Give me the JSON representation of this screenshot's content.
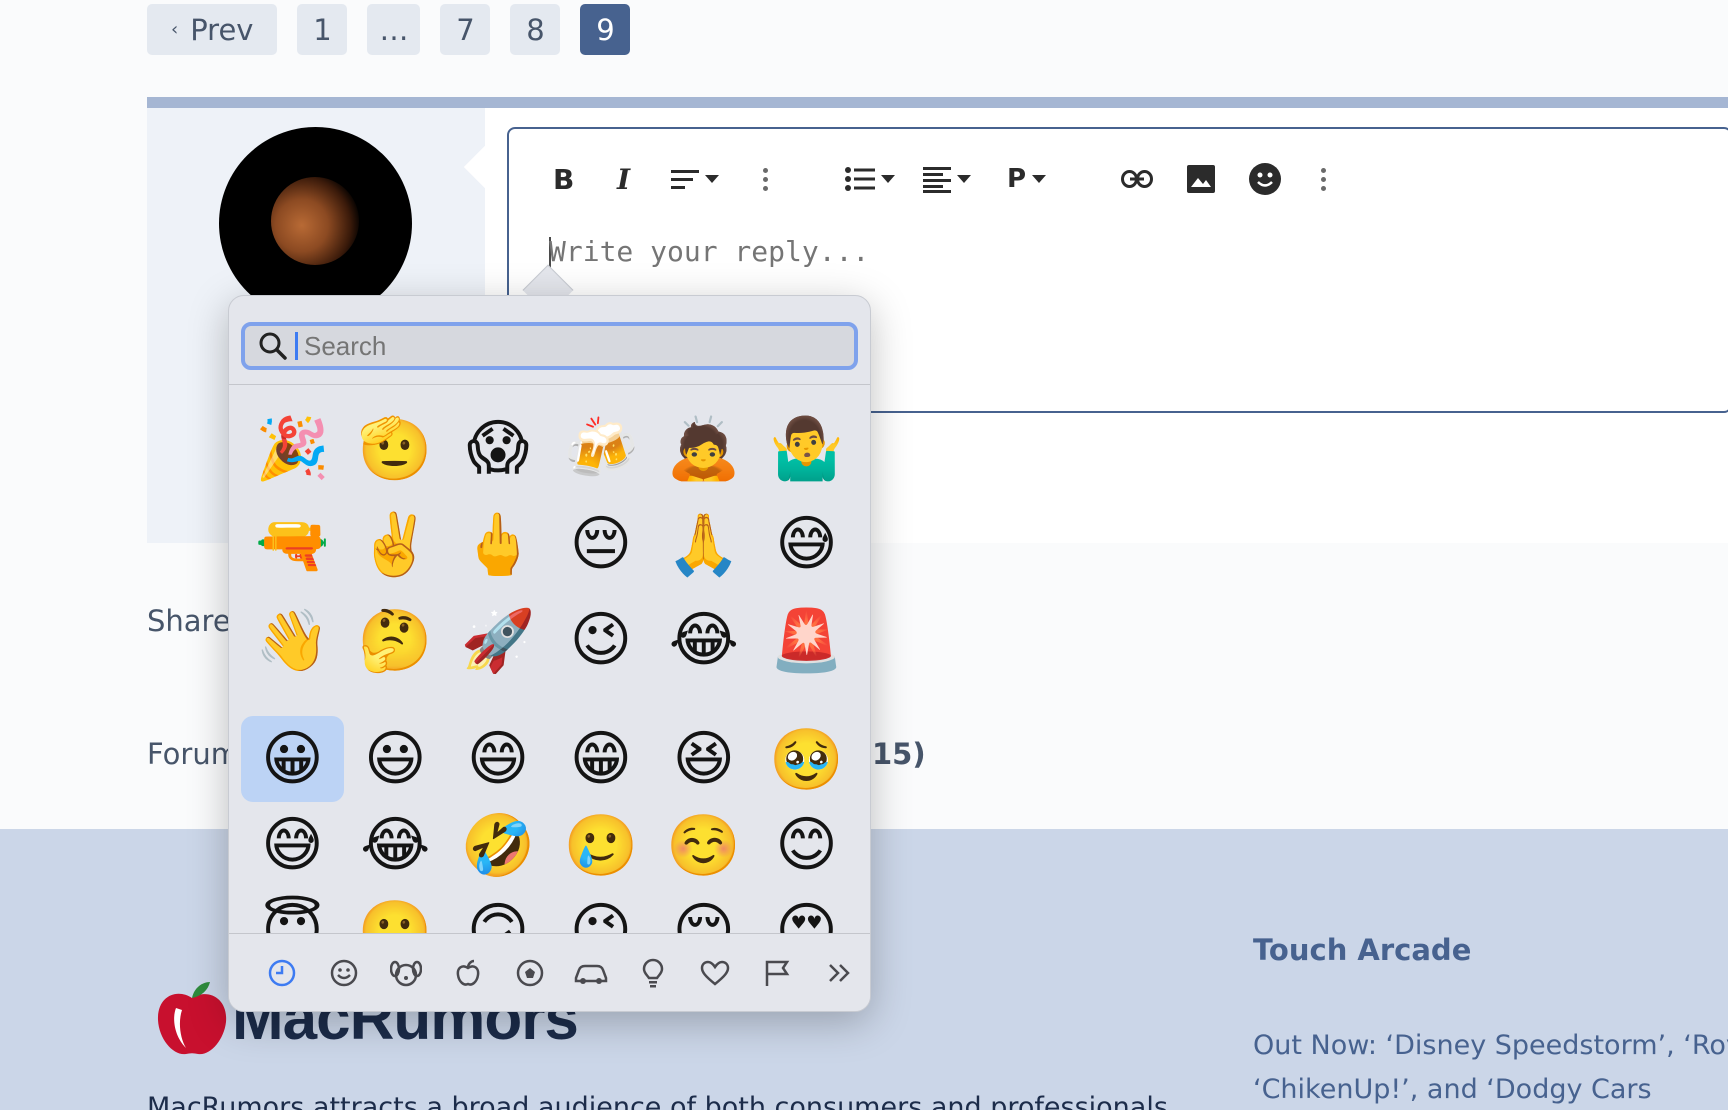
{
  "pagination": {
    "prev_label": "Prev",
    "pages": [
      "1",
      "…",
      "7",
      "8",
      "9"
    ],
    "current": "9"
  },
  "editor": {
    "placeholder": "Write your reply..."
  },
  "labels": {
    "share": "Share",
    "forum": "Forum",
    "forum_number": "15)"
  },
  "footer": {
    "logo_text": "MacRumors",
    "description": "MacRumors attracts a broad audience of both consumers and professionals",
    "touch_arcade_title": "Touch Arcade",
    "touch_arcade_lines": [
      "Out Now: ‘Disney Speedstorm’, ‘Roy",
      "‘ChikenUp!’, and ‘Dodgy Cars"
    ]
  },
  "emoji_picker": {
    "search_placeholder": "Search",
    "recents": [
      "🎉",
      "🫡",
      "😱",
      "🍻",
      "🙇",
      "🤷‍♂️",
      "🔫",
      "✌️",
      "🖕",
      "😔",
      "🙏",
      "😅",
      "👋",
      "🤔",
      "🚀",
      "😉",
      "😂",
      "🚨"
    ],
    "smileys": [
      "😀",
      "😃",
      "😄",
      "😁",
      "😆",
      "🥹",
      "😅",
      "😂",
      "🤣",
      "🥲",
      "☺️",
      "😊",
      "😇",
      "🙂",
      "🙃",
      "😉",
      "😌",
      "😍"
    ],
    "selected_index": 0,
    "categories": [
      "recent",
      "smileys",
      "animals",
      "food",
      "activity",
      "travel",
      "objects",
      "symbols",
      "flags",
      "more"
    ]
  }
}
